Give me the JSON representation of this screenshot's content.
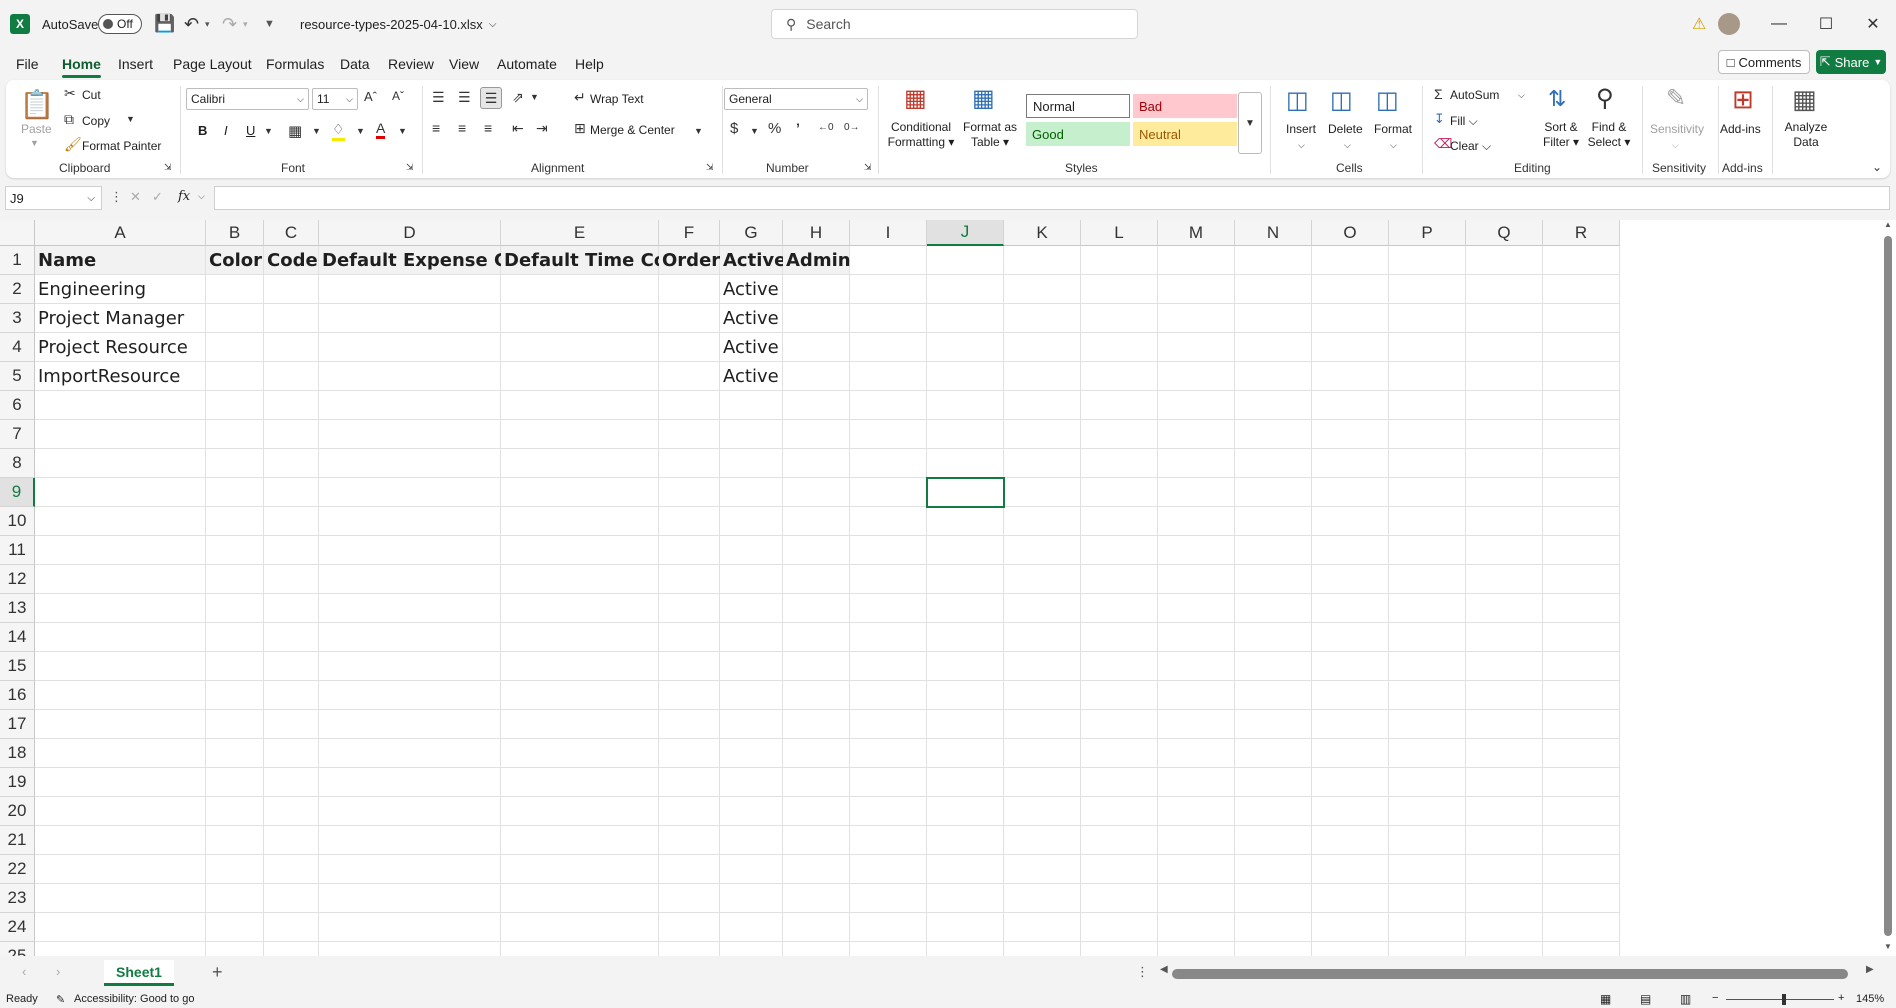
{
  "titlebar": {
    "app_logo": "X",
    "autosave_label": "AutoSave",
    "autosave_state": "Off",
    "file_name": "resource-types-2025-04-10.xlsx",
    "search_placeholder": "Search"
  },
  "menu": {
    "tabs": [
      "File",
      "Home",
      "Insert",
      "Page Layout",
      "Formulas",
      "Data",
      "Review",
      "View",
      "Automate",
      "Help"
    ],
    "active": "Home",
    "comments_label": "Comments",
    "share_label": "Share"
  },
  "ribbon": {
    "clipboard": {
      "paste": "Paste",
      "cut": "Cut",
      "copy": "Copy",
      "format_painter": "Format Painter",
      "group": "Clipboard"
    },
    "font": {
      "name": "Calibri",
      "size": "11",
      "bold": "B",
      "italic": "I",
      "underline": "U",
      "group": "Font"
    },
    "alignment": {
      "wrap_text": "Wrap Text",
      "merge_center": "Merge & Center",
      "group": "Alignment"
    },
    "number": {
      "format": "General",
      "group": "Number"
    },
    "styles": {
      "conditional_formatting": [
        "Conditional",
        "Formatting"
      ],
      "format_as_table": [
        "Format as",
        "Table"
      ],
      "normal": "Normal",
      "bad": "Bad",
      "good": "Good",
      "neutral": "Neutral",
      "group": "Styles"
    },
    "cells": {
      "insert": "Insert",
      "delete": "Delete",
      "format": "Format",
      "group": "Cells"
    },
    "editing": {
      "autosum": "AutoSum",
      "fill": "Fill",
      "clear": "Clear",
      "sort_filter": [
        "Sort &",
        "Filter"
      ],
      "find_select": [
        "Find &",
        "Select"
      ],
      "group": "Editing"
    },
    "sensitivity": {
      "label": "Sensitivity",
      "group": "Sensitivity"
    },
    "addins": {
      "label": "Add-ins",
      "analyze": [
        "Analyze",
        "Data"
      ],
      "group": "Add-ins"
    }
  },
  "formula_bar": {
    "name_box": "J9",
    "fx": "fx",
    "value": ""
  },
  "sheet": {
    "columns": [
      "A",
      "B",
      "C",
      "D",
      "E",
      "F",
      "G",
      "H",
      "I",
      "J",
      "K",
      "L",
      "M",
      "N",
      "O",
      "P",
      "Q",
      "R"
    ],
    "selected_col": "J",
    "selected_row": 9,
    "rows": [
      1,
      2,
      3,
      4,
      5,
      6,
      7,
      8,
      9,
      10,
      11,
      12,
      13,
      14,
      15,
      16,
      17,
      18,
      19,
      20,
      21,
      22,
      23,
      24,
      25
    ],
    "headers": [
      "Name",
      "Color",
      "Code",
      "Default Expense Code",
      "Default Time Code",
      "Order",
      "Active",
      "Admin"
    ],
    "data": [
      {
        "name": "Engineering",
        "active": "Active"
      },
      {
        "name": "Project Manager",
        "active": "Active"
      },
      {
        "name": "Project Resource",
        "active": "Active"
      },
      {
        "name": "ImportResource",
        "active": "Active"
      }
    ]
  },
  "sheet_tabs": {
    "active": "Sheet1"
  },
  "status": {
    "ready": "Ready",
    "accessibility": "Accessibility: Good to go",
    "zoom": "145%"
  }
}
